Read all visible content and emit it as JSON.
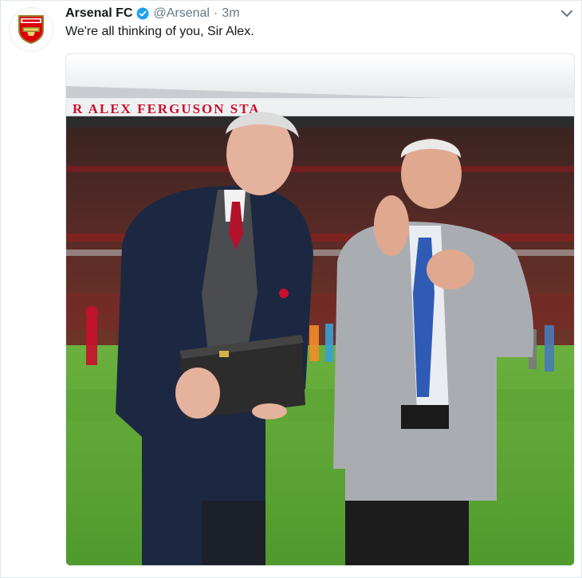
{
  "tweet": {
    "account_name": "Arsenal FC",
    "handle": "@Arsenal",
    "separator": "·",
    "time": "3m",
    "text": "We're all thinking of you, Sir Alex.",
    "verified": true,
    "verified_icon": "verified-badge-icon",
    "menu_icon": "chevron-down-icon",
    "avatar_icon": "arsenal-crest-icon"
  },
  "photo": {
    "stadium_sign": "R ALEX FERGUSON STA"
  },
  "colors": {
    "brand_blue": "#1da1f2",
    "text_primary": "#14171a",
    "text_secondary": "#657786",
    "arsenal_red": "#db0007"
  }
}
